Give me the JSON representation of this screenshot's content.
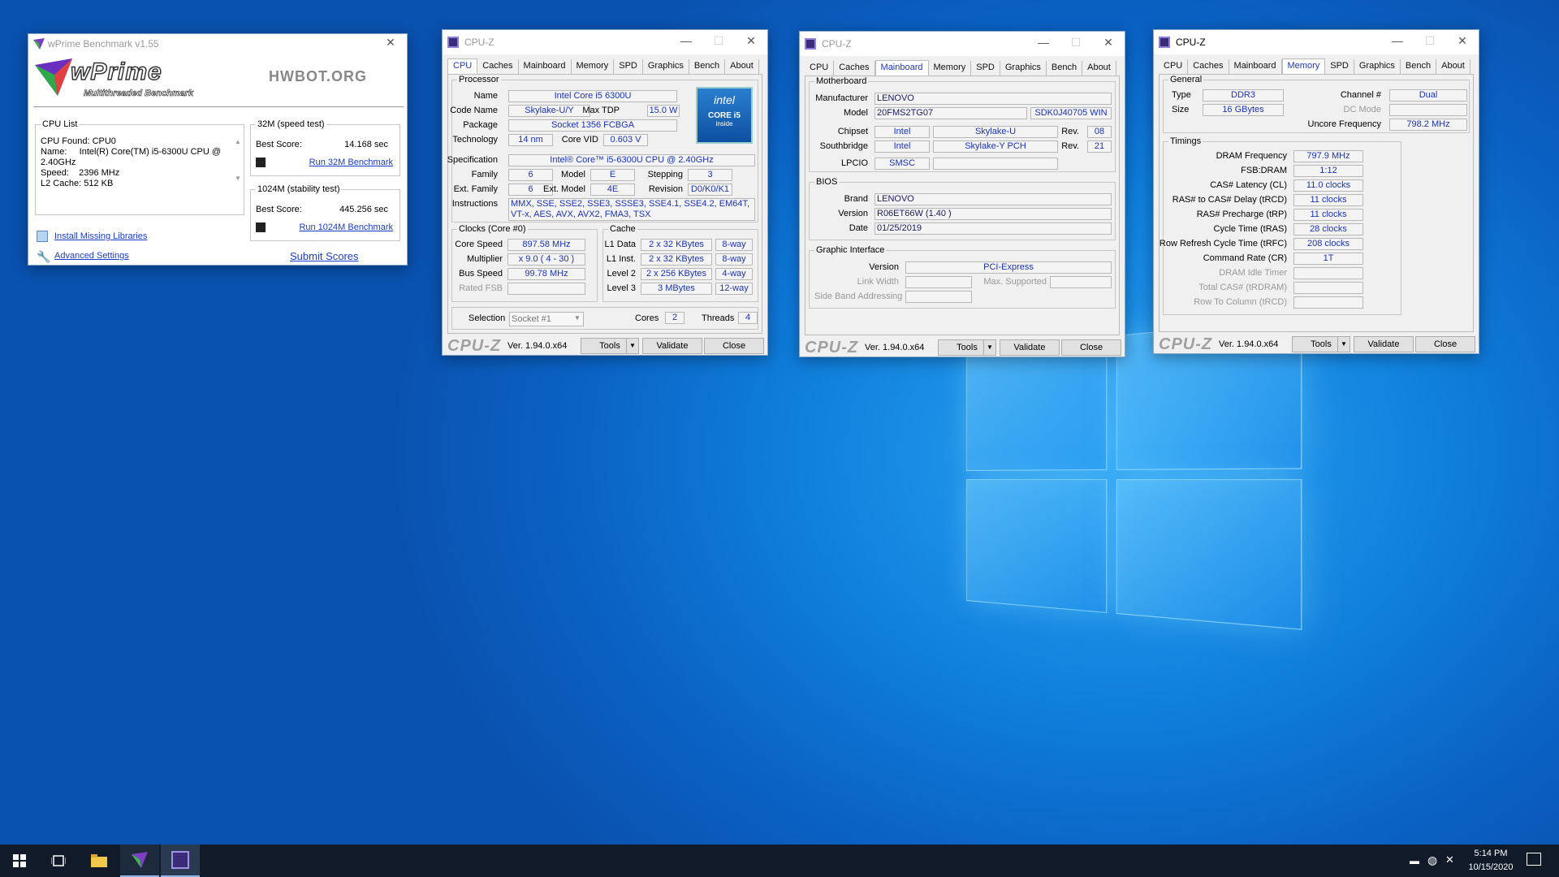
{
  "wprime": {
    "title": "wPrime Benchmark v1.55",
    "logo_main": "wPrime",
    "logo_sub": "Multithreaded Benchmark",
    "hwbot": "HWBOT.ORG",
    "cpu_list_label": "CPU List",
    "cpu_lines": [
      "CPU Found: CPU0",
      "Name:     Intel(R) Core(TM) i5-6300U CPU @",
      "2.40GHz",
      "Speed:    2396 MHz",
      "L2 Cache: 512 KB"
    ],
    "speed_label": "32M (speed test)",
    "best_label": "Best Score:",
    "speed_score": "14.168 sec",
    "run32": "Run 32M Benchmark",
    "stab_label": "1024M (stability test)",
    "stab_score": "445.256 sec",
    "run1024": "Run 1024M Benchmark",
    "install": "Install Missing Libraries",
    "advanced": "Advanced Settings",
    "submit": "Submit Scores"
  },
  "cpuz_common": {
    "title": "CPU-Z",
    "brand": "CPU-Z",
    "version": "Ver. 1.94.0.x64",
    "tools": "Tools",
    "validate": "Validate",
    "close": "Close",
    "tabs": [
      "CPU",
      "Caches",
      "Mainboard",
      "Memory",
      "SPD",
      "Graphics",
      "Bench",
      "About"
    ]
  },
  "cpu": {
    "processor_label": "Processor",
    "name_l": "Name",
    "name": "Intel Core i5 6300U",
    "code_l": "Code Name",
    "code": "Skylake-U/Y",
    "tdp_l": "Max TDP",
    "tdp": "15.0 W",
    "pkg_l": "Package",
    "pkg": "Socket 1356 FCBGA",
    "tech_l": "Technology",
    "tech": "14 nm",
    "vid_l": "Core VID",
    "vid": "0.603 V",
    "spec_l": "Specification",
    "spec": "Intel® Core™ i5-6300U CPU @ 2.40GHz",
    "fam_l": "Family",
    "fam": "6",
    "model_l": "Model",
    "model": "E",
    "step_l": "Stepping",
    "step": "3",
    "efam_l": "Ext. Family",
    "efam": "6",
    "emodel_l": "Ext. Model",
    "emodel": "4E",
    "rev_l": "Revision",
    "rev": "D0/K0/K1",
    "ins_l": "Instructions",
    "ins": "MMX, SSE, SSE2, SSE3, SSSE3, SSE4.1, SSE4.2, EM64T, VT-x, AES, AVX, AVX2, FMA3, TSX",
    "clocks_label": "Clocks (Core #0)",
    "cs_l": "Core Speed",
    "cs": "897.58 MHz",
    "mul_l": "Multiplier",
    "mul": "x 9.0 ( 4 - 30 )",
    "bus_l": "Bus Speed",
    "bus": "99.78 MHz",
    "fsb_l": "Rated FSB",
    "fsb": "",
    "cache_label": "Cache",
    "l1d_l": "L1 Data",
    "l1d": "2 x 32 KBytes",
    "l1d_w": "8-way",
    "l1i_l": "L1 Inst.",
    "l1i": "2 x 32 KBytes",
    "l1i_w": "8-way",
    "l2_l": "Level 2",
    "l2": "2 x 256 KBytes",
    "l2_w": "4-way",
    "l3_l": "Level 3",
    "l3": "3 MBytes",
    "l3_w": "12-way",
    "sel_l": "Selection",
    "sel": "Socket #1",
    "cores_l": "Cores",
    "cores": "2",
    "thr_l": "Threads",
    "thr": "4",
    "badge_top": "intel",
    "badge_mid": "CORE i5",
    "badge_bot": "inside"
  },
  "mb": {
    "mb_label": "Motherboard",
    "man_l": "Manufacturer",
    "man": "LENOVO",
    "mod_l": "Model",
    "mod": "20FMS2TG07",
    "mod2": "SDK0J40705 WIN",
    "chip_l": "Chipset",
    "chip1": "Intel",
    "chip2": "Skylake-U",
    "rev_l": "Rev.",
    "chip_rev": "08",
    "sb_l": "Southbridge",
    "sb1": "Intel",
    "sb2": "Skylake-Y PCH",
    "sb_rev": "21",
    "lpcio_l": "LPCIO",
    "lpcio": "SMSC",
    "bios_label": "BIOS",
    "brand_l": "Brand",
    "brand": "LENOVO",
    "ver_l": "Version",
    "ver": "R06ET66W (1.40 )",
    "date_l": "Date",
    "date": "01/25/2019",
    "gi_label": "Graphic Interface",
    "giver_l": "Version",
    "giver": "PCI-Express",
    "lw_l": "Link Width",
    "ms_l": "Max. Supported",
    "sba_l": "Side Band Addressing"
  },
  "mem": {
    "gen_label": "General",
    "type_l": "Type",
    "type": "DDR3",
    "ch_l": "Channel #",
    "ch": "Dual",
    "size_l": "Size",
    "size": "16 GBytes",
    "dc_l": "DC Mode",
    "unc_l": "Uncore Frequency",
    "unc": "798.2 MHz",
    "tim_label": "Timings",
    "timings": [
      [
        "DRAM Frequency",
        "797.9 MHz",
        false
      ],
      [
        "FSB:DRAM",
        "1:12",
        false
      ],
      [
        "CAS# Latency (CL)",
        "11.0 clocks",
        false
      ],
      [
        "RAS# to CAS# Delay (tRCD)",
        "11 clocks",
        false
      ],
      [
        "RAS# Precharge (tRP)",
        "11 clocks",
        false
      ],
      [
        "Cycle Time (tRAS)",
        "28 clocks",
        false
      ],
      [
        "Row Refresh Cycle Time (tRFC)",
        "208 clocks",
        false
      ],
      [
        "Command Rate (CR)",
        "1T",
        false
      ],
      [
        "DRAM Idle Timer",
        "",
        true
      ],
      [
        "Total CAS# (tRDRAM)",
        "",
        true
      ],
      [
        "Row To Column (tRCD)",
        "",
        true
      ]
    ]
  },
  "taskbar": {
    "time": "5:14 PM",
    "date": "10/15/2020"
  },
  "colors": {
    "desktop": "#0f7fdc",
    "taskbar": "#101a28",
    "value": "#1a32b8"
  }
}
